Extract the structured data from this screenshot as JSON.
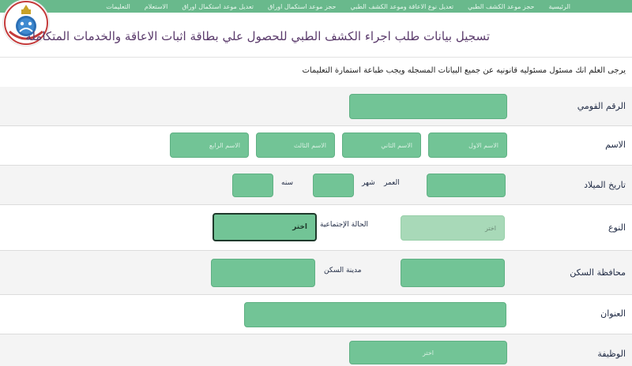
{
  "nav": {
    "items": [
      "الرئيسية",
      "حجز موعد الكشف الطبي",
      "تعديل نوع الاعاقة وموعد الكشف الطبي",
      "حجز موعد استكمال اوراق",
      "تعديل موعد استكمال اوراق",
      "الاستعلام",
      "التعليمات"
    ]
  },
  "header": {
    "title": "تسجيل بيانات طلب اجراء الكشف الطبي للحصول علي بطاقة اثبات الاعاقة والخدمات المتكامله"
  },
  "notice": "يرجى العلم انك مسئول مسئوليه قانونيه عن جميع البيانات المسجله ويجب طباعة استمارة التعليمات",
  "form": {
    "national_id": {
      "label": "الرقم القومي",
      "value": ""
    },
    "name": {
      "label": "الاسم",
      "first_placeholder": "الاسم الاول",
      "second_placeholder": "الاسم الثاني",
      "third_placeholder": "الاسم الثالث",
      "fourth_placeholder": "الاسم الرابع"
    },
    "birth": {
      "label": "تاريخ الميلاد",
      "age_label": "العمر",
      "month_label": "شهر",
      "year_label": "سنه"
    },
    "gender": {
      "label": "النوع",
      "value": "اختر",
      "marital_label": "الحالة الإجتماعية",
      "marital_value": "اختر"
    },
    "residence": {
      "label": "محافظة السكن",
      "city_label": "مدينة السكن"
    },
    "address": {
      "label": "العنوان"
    },
    "job": {
      "label": "الوظيفة",
      "value": "اختر"
    }
  },
  "colors": {
    "nav_bg": "#69b98c",
    "field": "#72c496",
    "title": "#5a3a6b"
  }
}
